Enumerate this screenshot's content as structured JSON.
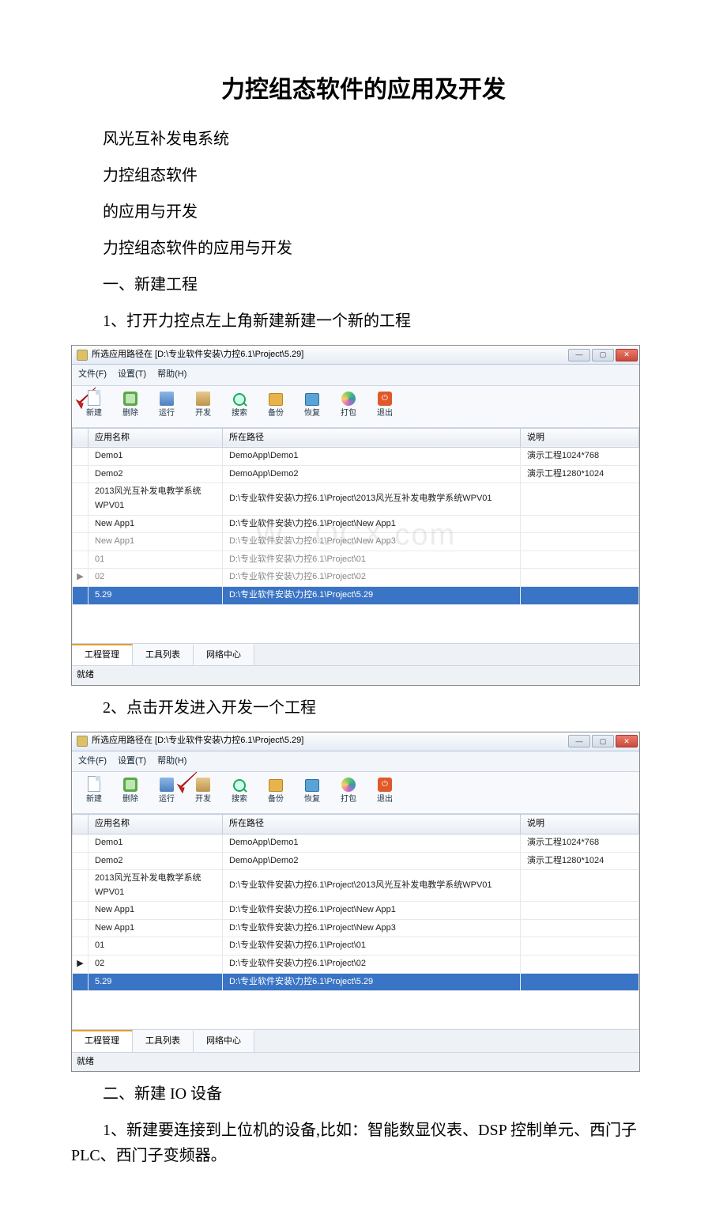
{
  "doc": {
    "title": "力控组态软件的应用及开发",
    "p1": "风光互补发电系统",
    "p2": "力控组态软件",
    "p3": "的应用与开发",
    "p4": "力控组态软件的应用与开发",
    "s1": "一、新建工程",
    "s1_1": "1、打开力控点左上角新建新建一个新的工程",
    "s1_2": "2、点击开发进入开发一个工程",
    "s2": "二、新建 IO 设备",
    "s2_1": "1、新建要连接到上位机的设备,比如：智能数显仪表、DSP 控制单元、西门子 PLC、西门子变频器。"
  },
  "win": {
    "title": "所选应用路径在 [D:\\专业软件安装\\力控6.1\\Project\\5.29]",
    "menu": {
      "file": "文件(F)",
      "settings": "设置(T)",
      "help": "帮助(H)"
    },
    "toolbar": {
      "new": "新建",
      "del": "删除",
      "run": "运行",
      "dev": "开发",
      "search": "搜索",
      "backup": "备份",
      "restore": "恢复",
      "pack": "打包",
      "exit": "退出"
    },
    "cols": {
      "name": "应用名称",
      "path": "所在路径",
      "desc": "说明"
    },
    "rows": [
      {
        "name": "Demo1",
        "path": "DemoApp\\Demo1",
        "desc": "演示工程1024*768"
      },
      {
        "name": "Demo2",
        "path": "DemoApp\\Demo2",
        "desc": "演示工程1280*1024"
      },
      {
        "name": "2013风光互补发电教学系统WPV01",
        "path": "D:\\专业软件安装\\力控6.1\\Project\\2013风光互补发电教学系统WPV01",
        "desc": ""
      },
      {
        "name": "New App1",
        "path": "D:\\专业软件安装\\力控6.1\\Project\\New App1",
        "desc": ""
      },
      {
        "name": "New App1",
        "path": "D:\\专业软件安装\\力控6.1\\Project\\New App3",
        "desc": ""
      },
      {
        "name": "01",
        "path": "D:\\专业软件安装\\力控6.1\\Project\\01",
        "desc": ""
      },
      {
        "name": "02",
        "path": "D:\\专业软件安装\\力控6.1\\Project\\02",
        "desc": ""
      },
      {
        "name": "5.29",
        "path": "D:\\专业软件安装\\力控6.1\\Project\\5.29",
        "desc": ""
      }
    ],
    "tabs": {
      "proj": "工程管理",
      "tools": "工具列表",
      "net": "网络中心"
    },
    "status": "就绪",
    "watermark": "W   .   OCX.com"
  }
}
